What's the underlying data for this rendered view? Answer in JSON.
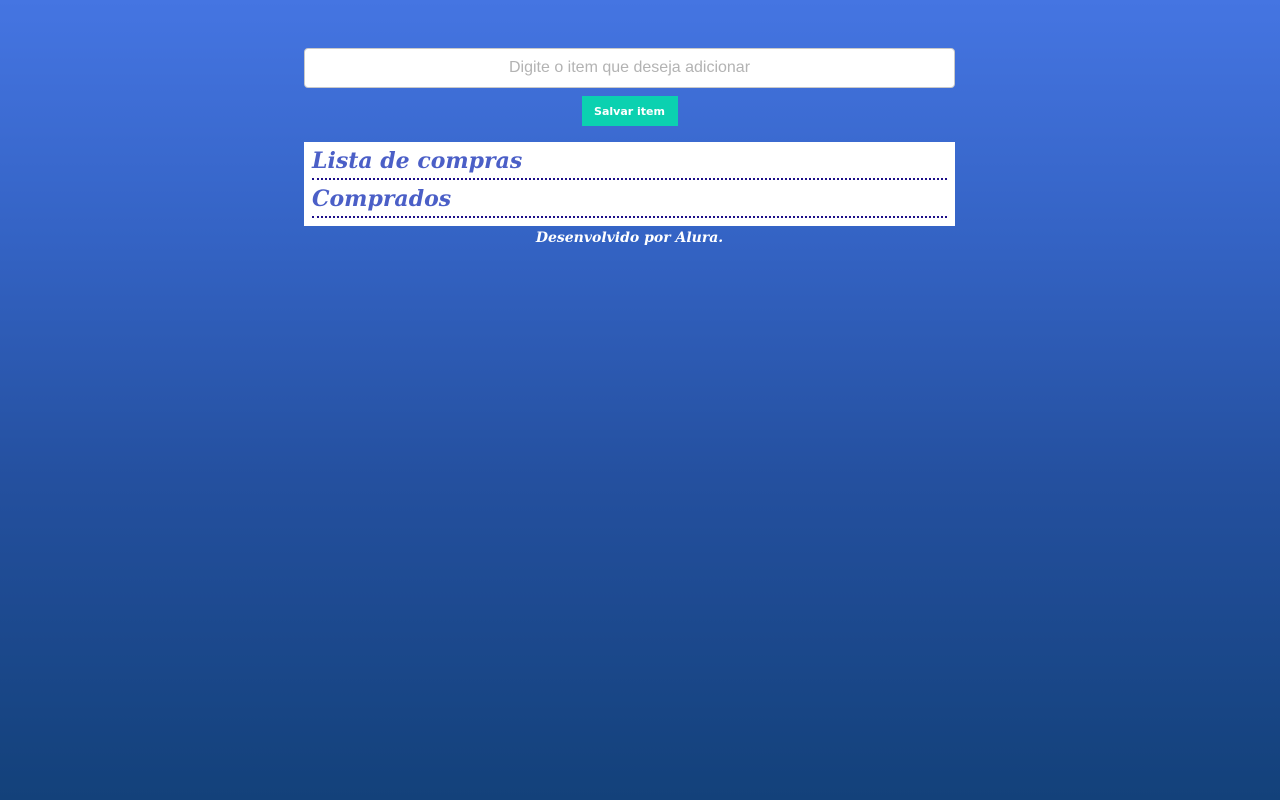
{
  "form": {
    "input_placeholder": "Digite o item que deseja adicionar",
    "input_value": "",
    "save_label": "Salvar item"
  },
  "lists": [
    {
      "title": "Lista de compras",
      "items": []
    },
    {
      "title": "Comprados",
      "items": []
    }
  ],
  "footer": {
    "text": "Desenvolvido por Alura."
  },
  "colors": {
    "background_top": "#4575e2",
    "background_bottom": "#13417a",
    "accent_button": "#0bd1b0",
    "heading": "#4b5fc7",
    "divider": "#1d0f88"
  }
}
